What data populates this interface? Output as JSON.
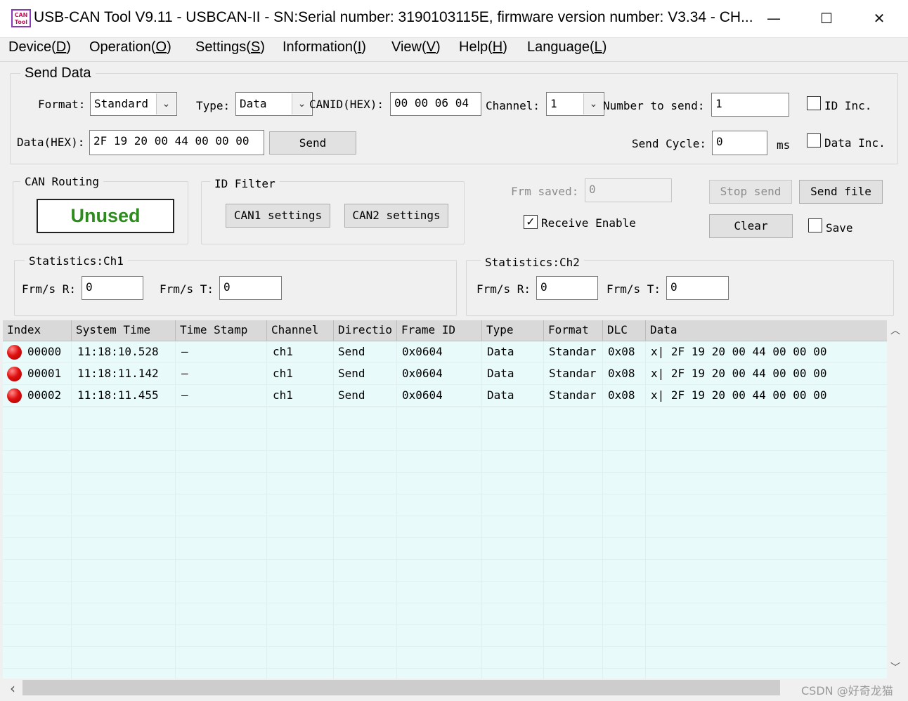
{
  "window": {
    "title": "USB-CAN Tool V9.11 - USBCAN-II - SN:Serial number: 3190103115E, firmware version number: V3.34 - CH...",
    "icon_text_top": "CAN",
    "icon_text_bottom": "Tool",
    "minimize": "—",
    "maximize": "☐",
    "close": "✕"
  },
  "menu": [
    {
      "label": "Device(",
      "key": "D",
      "end": ")"
    },
    {
      "label": "Operation(",
      "key": "O",
      "end": ")"
    },
    {
      "label": "Settings(",
      "key": "S",
      "end": ")"
    },
    {
      "label": "Information(",
      "key": "I",
      "end": ")"
    },
    {
      "label": "View(",
      "key": "V",
      "end": ")"
    },
    {
      "label": "Help(",
      "key": "H",
      "end": ")"
    },
    {
      "label": "Language(",
      "key": "L",
      "end": ")"
    }
  ],
  "send_data": {
    "title": "Send Data",
    "format_label": "Format:",
    "format_value": "Standard",
    "type_label": "Type:",
    "type_value": "Data",
    "canid_label": "CANID(HEX):",
    "canid_value": "00 00 06 04",
    "channel_label": "Channel:",
    "channel_value": "1",
    "number_label": "Number to send:",
    "number_value": "1",
    "id_inc_label": "ID Inc.",
    "data_label": "Data(HEX):",
    "data_value": "2F 19 20 00 44 00 00 00",
    "send_button": "Send",
    "cycle_label": "Send Cycle:",
    "cycle_value": "0",
    "cycle_unit": "ms",
    "data_inc_label": "Data Inc."
  },
  "can_routing": {
    "title": "CAN Routing",
    "status": "Unused",
    "status_color": "#2e8b1e"
  },
  "id_filter": {
    "title": "ID Filter",
    "can1_button": "CAN1 settings",
    "can2_button": "CAN2 settings"
  },
  "controls": {
    "frm_saved_label": "Frm saved:",
    "frm_saved_value": "0",
    "stop_send": "Stop send",
    "send_file": "Send file",
    "receive_enable": "Receive Enable",
    "receive_checked": "✓",
    "clear": "Clear",
    "save": "Save"
  },
  "stats_ch1": {
    "title": "Statistics:Ch1",
    "r_label": "Frm/s R:",
    "r_value": "0",
    "t_label": "Frm/s T:",
    "t_value": "0"
  },
  "stats_ch2": {
    "title": "Statistics:Ch2",
    "r_label": "Frm/s R:",
    "r_value": "0",
    "t_label": "Frm/s T:",
    "t_value": "0"
  },
  "table": {
    "columns": [
      "Index",
      "System Time",
      "Time Stamp",
      "Channel",
      "Directio",
      "Frame ID",
      "Type",
      "Format",
      "DLC",
      "Data"
    ],
    "rows": [
      {
        "index": "00000",
        "time": "11:18:10.528",
        "stamp": "—",
        "channel": "ch1",
        "dir": "Send",
        "id": "0x0604",
        "type": "Data",
        "format": "Standar",
        "dlc": "0x08",
        "data": "x| 2F 19 20 00 44 00 00 00"
      },
      {
        "index": "00001",
        "time": "11:18:11.142",
        "stamp": "—",
        "channel": "ch1",
        "dir": "Send",
        "id": "0x0604",
        "type": "Data",
        "format": "Standar",
        "dlc": "0x08",
        "data": "x| 2F 19 20 00 44 00 00 00"
      },
      {
        "index": "00002",
        "time": "11:18:11.455",
        "stamp": "—",
        "channel": "ch1",
        "dir": "Send",
        "id": "0x0604",
        "type": "Data",
        "format": "Standar",
        "dlc": "0x08",
        "data": "x| 2F 19 20 00 44 00 00 00"
      }
    ]
  },
  "scroll": {
    "up": "︿",
    "down": "﹀",
    "left": "‹",
    "right": "›"
  },
  "watermark": "CSDN @好奇龙猫"
}
